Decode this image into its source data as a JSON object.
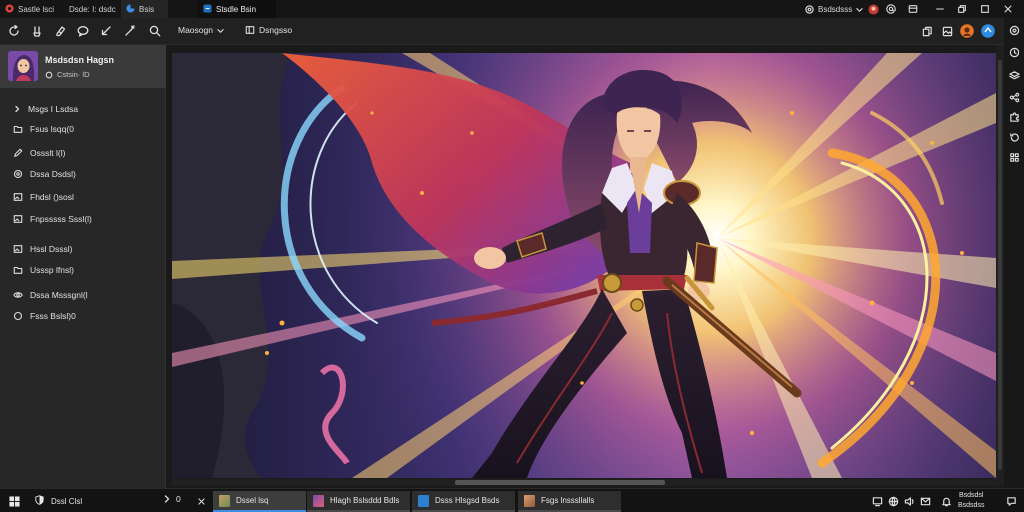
{
  "app": {
    "tabs": [
      {
        "label": "Sastle lsci",
        "icon": "app-logo-icon"
      },
      {
        "label": "Dsde: I: dsdc",
        "icon": ""
      },
      {
        "label": "Bsis",
        "icon": "browser-icon"
      },
      {
        "label": "Stsdle Bsin",
        "icon": "browser-icon"
      }
    ],
    "account_label": "Bsdsdsss"
  },
  "toolbar": {
    "icons": [
      "back-icon",
      "brush-icon",
      "eraser-icon",
      "comment-icon",
      "arrow-icon",
      "wand-icon",
      "search-icon"
    ],
    "menu_label": "Maosogn",
    "view_label": "Dsngsso"
  },
  "sidebar": {
    "profile": {
      "name": "Msdsdsn Hagsn",
      "status": "Cstsin· lD"
    },
    "items": [
      {
        "label": "Msgs I Lsdsa",
        "icon": "chevron-right-icon"
      },
      {
        "label": "Fsus lsqq(0",
        "icon": "folder-icon"
      },
      {
        "label": "Ossslt l(l)",
        "icon": "pen-icon"
      },
      {
        "label": "Dssa Dsdsl)",
        "icon": "circle-icon"
      },
      {
        "label": "Fhdsl ()sosl",
        "icon": "image-icon"
      },
      {
        "label": "Fnpsssss Sssl(l)",
        "icon": "image-icon"
      },
      {
        "label": "Hssl Dsssl)",
        "icon": "image-icon"
      },
      {
        "label": "Usssp lfnsl)",
        "icon": "folder-icon"
      },
      {
        "label": "Dssa Msssgnl(l",
        "icon": "eye-icon"
      },
      {
        "label": "Fsss Bslsl)0",
        "icon": "circle-icon"
      }
    ]
  },
  "right_panel_icons": [
    "settings-icon",
    "clock-icon",
    "layers-icon",
    "share-icon",
    "puzzle-icon",
    "history-icon",
    "grid-icon"
  ],
  "taskbar": {
    "search_label": "Dssl Clsl",
    "counter": "0",
    "apps": [
      {
        "label": "Dssel lsq",
        "icon": "image-app-icon"
      },
      {
        "label": "Hlagh Bslsddd Bdls",
        "icon": "image-app-icon"
      },
      {
        "label": "Dsss Hlsgsd Bsds",
        "icon": "document-app-icon"
      },
      {
        "label": "Fsgs lnsssllalls",
        "icon": "image-app-icon"
      }
    ],
    "clock": {
      "line1": "Bsdsdsl",
      "line2": "Bsdsdss"
    }
  },
  "colors": {
    "accent": "#3a8ee6",
    "brand_red": "#e0443a",
    "avatar_orange": "#e8742a",
    "avatar_blue": "#2f8be0"
  }
}
